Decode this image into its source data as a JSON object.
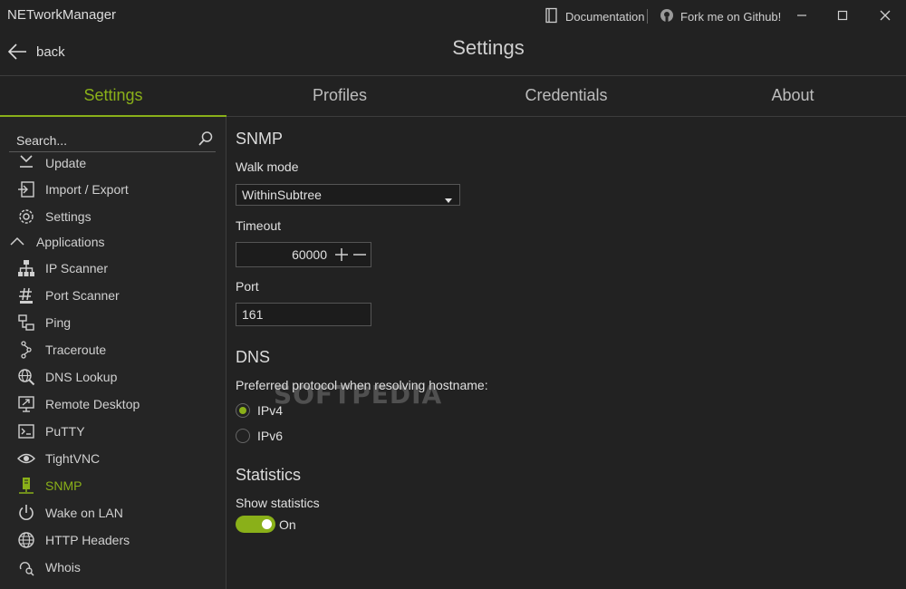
{
  "window": {
    "title": "NETworkManager",
    "links": {
      "documentation": "Documentation",
      "github": "Fork me on Github!"
    }
  },
  "header": {
    "back_label": "back",
    "title": "Settings"
  },
  "tabs": [
    {
      "label": "Settings",
      "active": true
    },
    {
      "label": "Profiles",
      "active": false
    },
    {
      "label": "Credentials",
      "active": false
    },
    {
      "label": "About",
      "active": false
    }
  ],
  "sidebar": {
    "search_placeholder": "Search...",
    "general_items": [
      {
        "label": "Update",
        "icon": "update-icon"
      },
      {
        "label": "Import / Export",
        "icon": "import-icon"
      },
      {
        "label": "Settings",
        "icon": "gear-icon"
      }
    ],
    "group_label": "Applications",
    "app_items": [
      {
        "label": "IP Scanner",
        "icon": "network-tree-icon",
        "active": false
      },
      {
        "label": "Port Scanner",
        "icon": "hash-icon",
        "active": false
      },
      {
        "label": "Ping",
        "icon": "ping-icon",
        "active": false
      },
      {
        "label": "Traceroute",
        "icon": "route-icon",
        "active": false
      },
      {
        "label": "DNS Lookup",
        "icon": "globe-search-icon",
        "active": false
      },
      {
        "label": "Remote Desktop",
        "icon": "remote-desktop-icon",
        "active": false
      },
      {
        "label": "PuTTY",
        "icon": "terminal-icon",
        "active": false
      },
      {
        "label": "TightVNC",
        "icon": "eye-icon",
        "active": false
      },
      {
        "label": "SNMP",
        "icon": "snmp-icon",
        "active": true
      },
      {
        "label": "Wake on LAN",
        "icon": "power-icon",
        "active": false
      },
      {
        "label": "HTTP Headers",
        "icon": "globe-icon",
        "active": false
      },
      {
        "label": "Whois",
        "icon": "whois-icon",
        "active": false
      }
    ]
  },
  "content": {
    "snmp": {
      "title": "SNMP",
      "walk_mode_label": "Walk mode",
      "walk_mode_value": "WithinSubtree",
      "timeout_label": "Timeout",
      "timeout_value": "60000",
      "port_label": "Port",
      "port_value": "161"
    },
    "dns": {
      "title": "DNS",
      "protocol_label": "Preferred protocol when resolving hostname:",
      "options": [
        {
          "label": "IPv4",
          "selected": true
        },
        {
          "label": "IPv6",
          "selected": false
        }
      ]
    },
    "statistics": {
      "title": "Statistics",
      "show_label": "Show statistics",
      "toggle_text": "On",
      "enabled": true
    }
  },
  "watermark": "SOFTPEDIA",
  "colors": {
    "accent": "#8ab019",
    "background": "#222222",
    "sidebar": "#252525",
    "text": "#e0e0e0"
  }
}
